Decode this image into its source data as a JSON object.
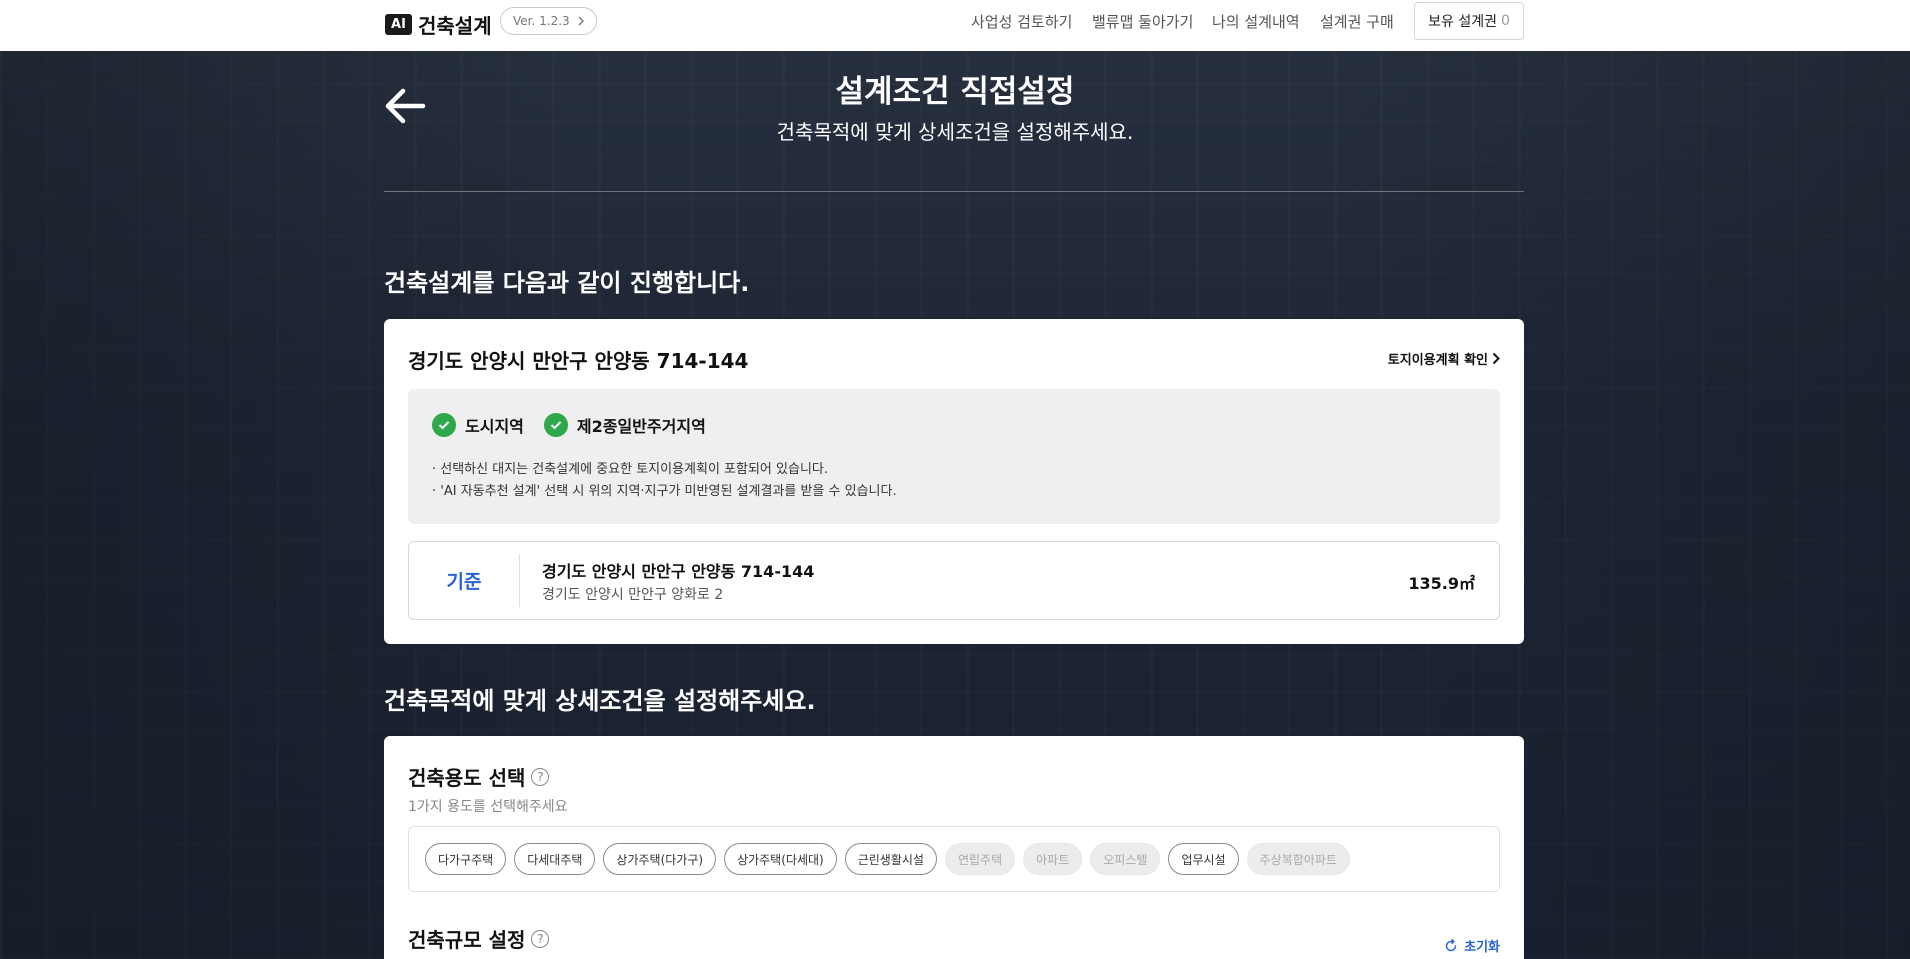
{
  "header": {
    "logo_badge": "AI",
    "logo_text": "건축설계",
    "version": "Ver. 1.2.3",
    "nav": [
      "사업성 검토하기",
      "밸류맵 둘아가기",
      "나의 설계내역",
      "설계권 구매"
    ],
    "hold_label": "보유 설계권",
    "hold_count": "0"
  },
  "hero": {
    "title": "설계조건 직접설정",
    "subtitle": "건축목적에 맞게 상세조건을 설정해주세요."
  },
  "section1": {
    "heading": "건축설계를 다음과 같이 진행합니다.",
    "address": "경기도 안양시 만안구 안양동 714-144",
    "land_link": "토지이용계획 확인",
    "zones": [
      "도시지역",
      "제2종일반주거지역"
    ],
    "notes": [
      "· 선택하신 대지는 건축설계에 중요한 토지이용계획이 포함되어 있습니다.",
      "· 'AI 자동추천 설계' 선택 시 위의 지역·지구가 미반영된 설계결과를 받을 수 있습니다."
    ],
    "standard": {
      "label": "기준",
      "address": "경기도 안양시 만안구 안양동 714-144",
      "road": "경기도 안양시 만안구 양화로 2",
      "area": "135.9㎡"
    }
  },
  "section2": {
    "heading": "건축목적에 맞게 상세조건을 설정해주세요.",
    "use_title": "건축용도 선택",
    "use_desc": "1가지 용도를 선택해주세요",
    "uses": [
      {
        "label": "다가구주택",
        "enabled": true
      },
      {
        "label": "다세대주택",
        "enabled": true
      },
      {
        "label": "상가주택(다가구)",
        "enabled": true
      },
      {
        "label": "상가주택(다세대)",
        "enabled": true
      },
      {
        "label": "근린생활시설",
        "enabled": true
      },
      {
        "label": "연립주택",
        "enabled": false
      },
      {
        "label": "아파트",
        "enabled": false
      },
      {
        "label": "오피스텔",
        "enabled": false
      },
      {
        "label": "업무시설",
        "enabled": true
      },
      {
        "label": "주상복합아파트",
        "enabled": false
      }
    ],
    "scale_title": "건축규모 설정",
    "reset_label": "초기화",
    "help_mark": "?"
  },
  "colors": {
    "accent": "#2a63d8",
    "check": "#2ea84a"
  }
}
